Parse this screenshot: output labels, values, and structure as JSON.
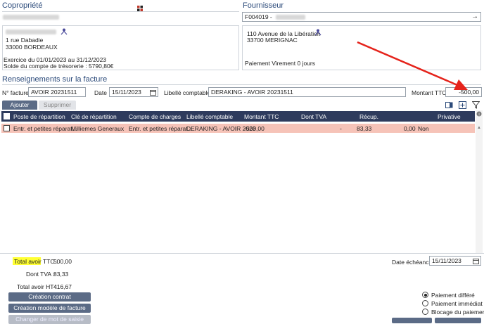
{
  "copro": {
    "title": "Copropriété",
    "address1": "1 rue Dabadie",
    "address2": "33000 BORDEAUX",
    "exercice": "Exercice du 01/01/2023 au 31/12/2023",
    "solde": "Solde du compte de trésorerie : 5790,80€"
  },
  "fournisseur": {
    "title": "Fournisseur",
    "code": "F004019 -",
    "address1": "110 Avenue de la Libération",
    "address2": "33700 MERIGNAC",
    "paiement": "Paiement Virement 0 jours"
  },
  "facture": {
    "section_title": "Renseignements sur la facture",
    "num_label": "N° facture :",
    "num_value": "AVOIR 20231511",
    "date_label": "Date :",
    "date_value": "15/11/2023",
    "libelle_label": "Libellé comptable :",
    "libelle_value": "DERAKING - AVOIR 20231511",
    "montant_label": "Montant TTC :",
    "montant_value": "-500,00"
  },
  "tabs": {
    "ajouter": "Ajouter",
    "supprimer": "Supprimer"
  },
  "table": {
    "headers": [
      "Poste de répartition",
      "Clé de répartition",
      "Compte de charges",
      "Libellé comptable",
      "Montant TTC",
      "Dont TVA",
      "Récup.",
      "Privative"
    ],
    "row": {
      "poste": "Entr. et petites réparat...",
      "cle": "Milliemes Generaux",
      "compte": "Entr. et petites réparat...",
      "libelle": "DERAKING - AVOIR 2023",
      "montant": "-500,00",
      "tva_sign": "-",
      "tva": "83,33",
      "recup": "0,00",
      "privative": "Non"
    }
  },
  "totals": {
    "ttc_label": "Total avoir TTC :",
    "ttc_value": "500,00",
    "tva_label": "Dont TVA :",
    "tva_value": "83,33",
    "ht_label": "Total avoir HT :",
    "ht_value": "416,67"
  },
  "buttons": {
    "creation_contrat": "Création contrat",
    "creation_modele": "Création modèle de facture",
    "changer_mot": "Changer de mot de saisie"
  },
  "echeance": {
    "label": "Date échéance :",
    "value": "15/11/2023"
  },
  "paiement": {
    "options": [
      "Paiement différé",
      "Paiement immédiat",
      "Blocage du paiement"
    ],
    "selected": 0
  },
  "colors": {
    "header_bg": "#2e3b5d",
    "row_highlight": "#f6c3b8",
    "arrow": "#e5231b",
    "highlight": "#ffff33"
  },
  "icons": [
    "grid-icon",
    "person-icon",
    "arrow-right-icon",
    "calendar-icon",
    "export-icon",
    "add-icon",
    "filter-icon",
    "scroll-up-icon"
  ]
}
